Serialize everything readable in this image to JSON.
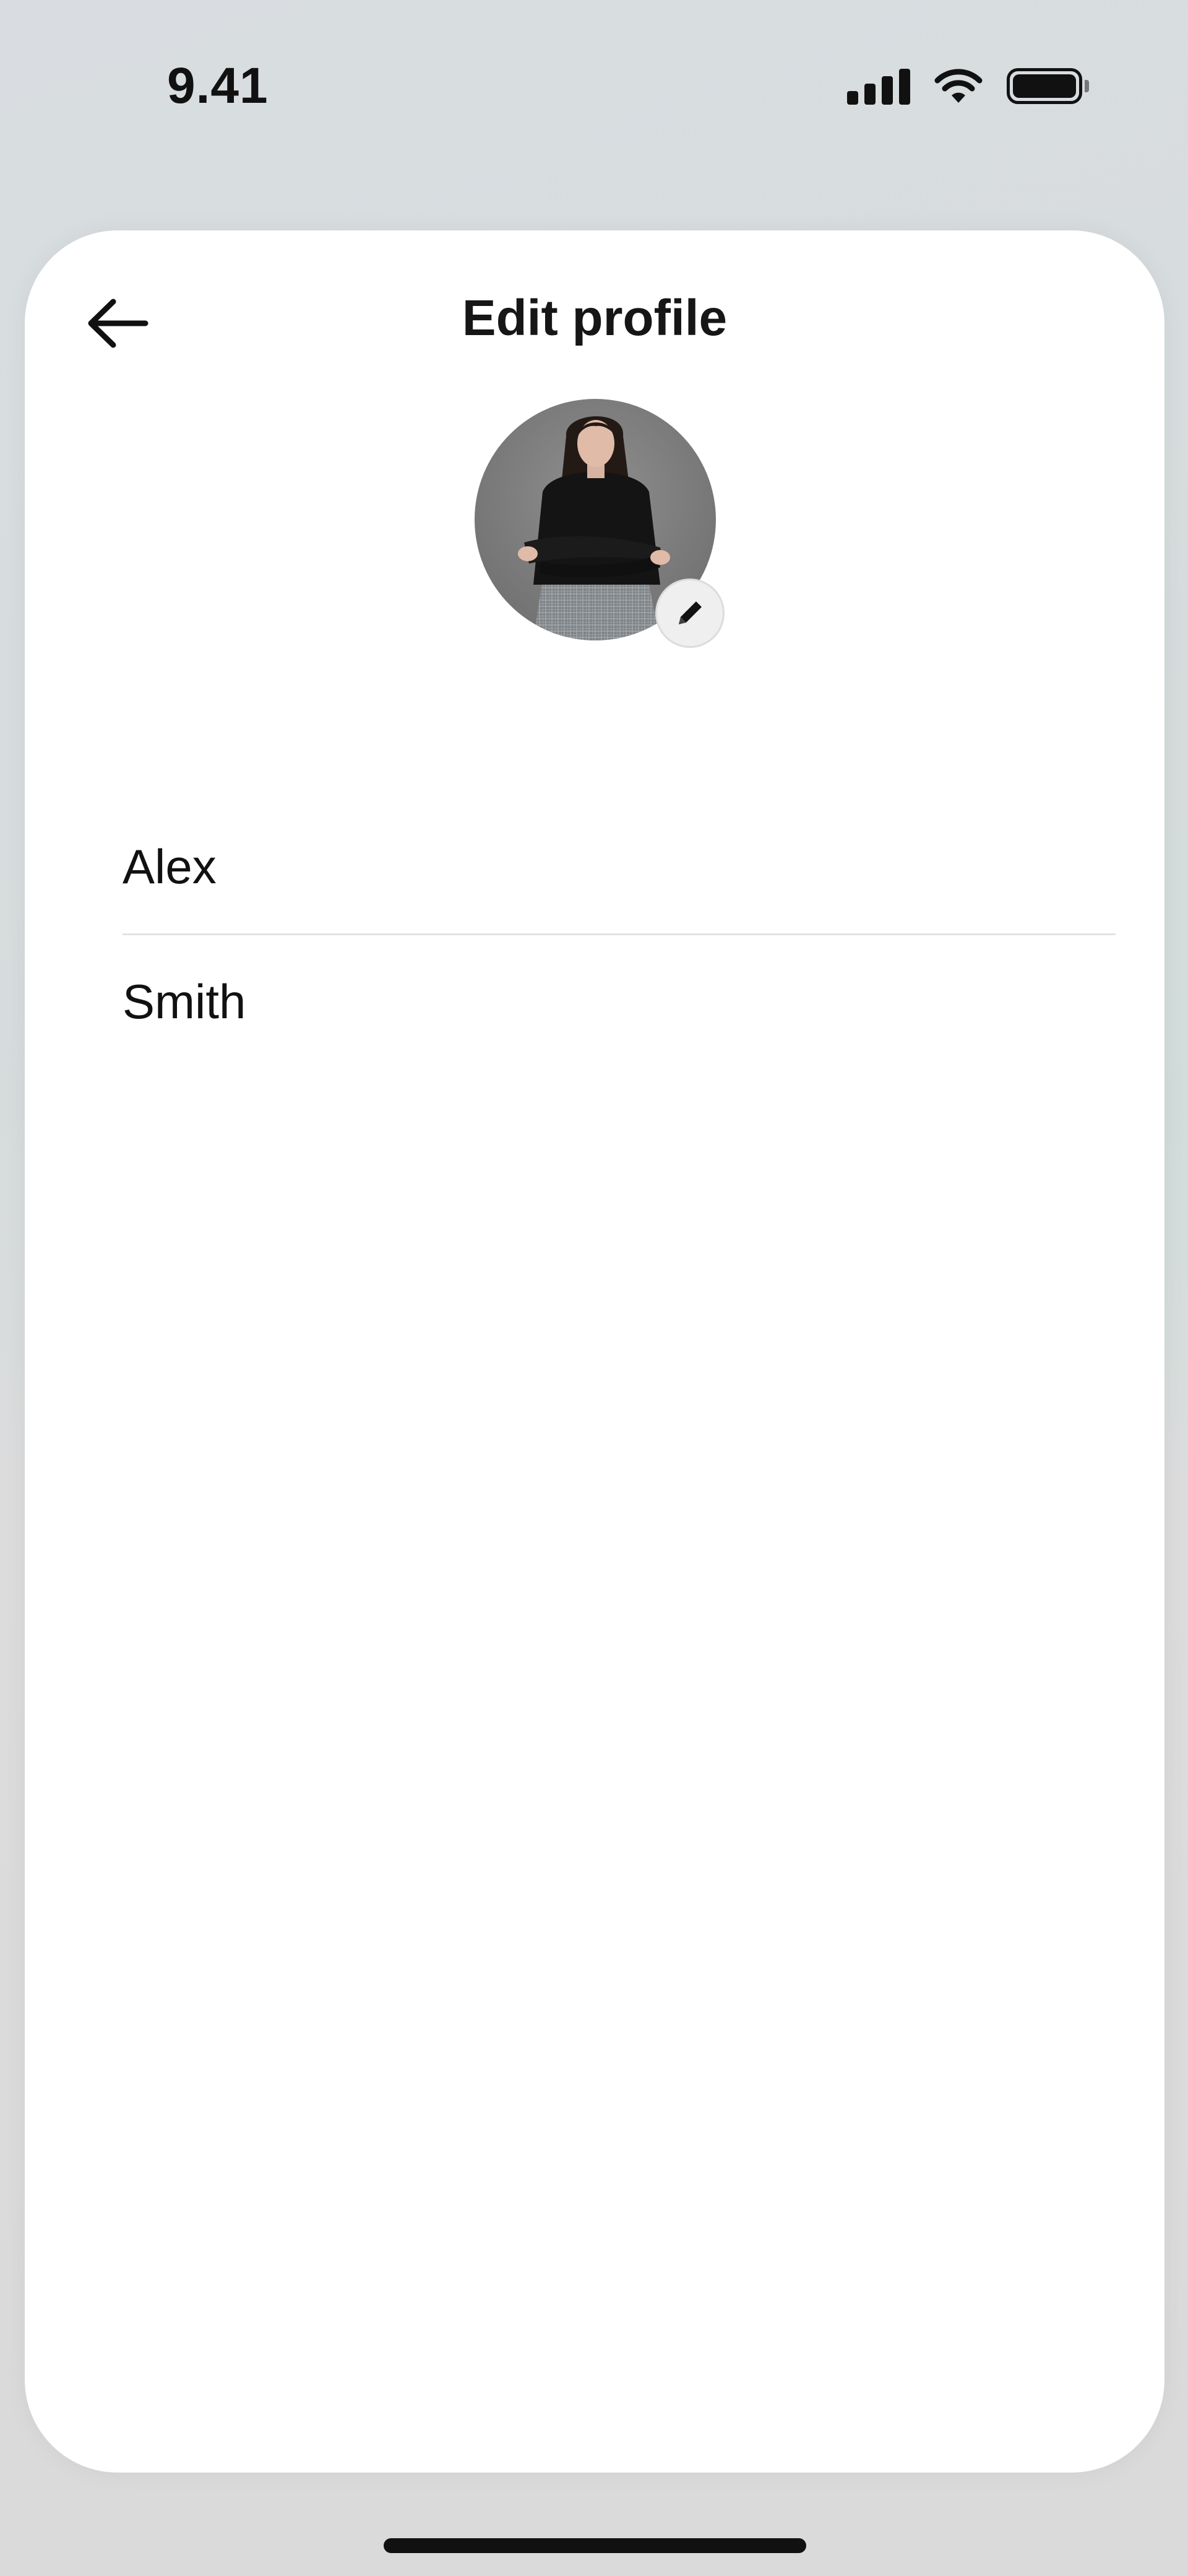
{
  "status_bar": {
    "time": "9.41"
  },
  "header": {
    "title": "Edit profile",
    "back_icon": "arrow-left-icon"
  },
  "avatar": {
    "edit_icon": "pencil-icon"
  },
  "form": {
    "first_name": "Alex",
    "last_name": "Smith"
  },
  "colors": {
    "sheet_background": "#ffffff",
    "text_primary": "#111111",
    "divider": "#e2e2e2"
  }
}
